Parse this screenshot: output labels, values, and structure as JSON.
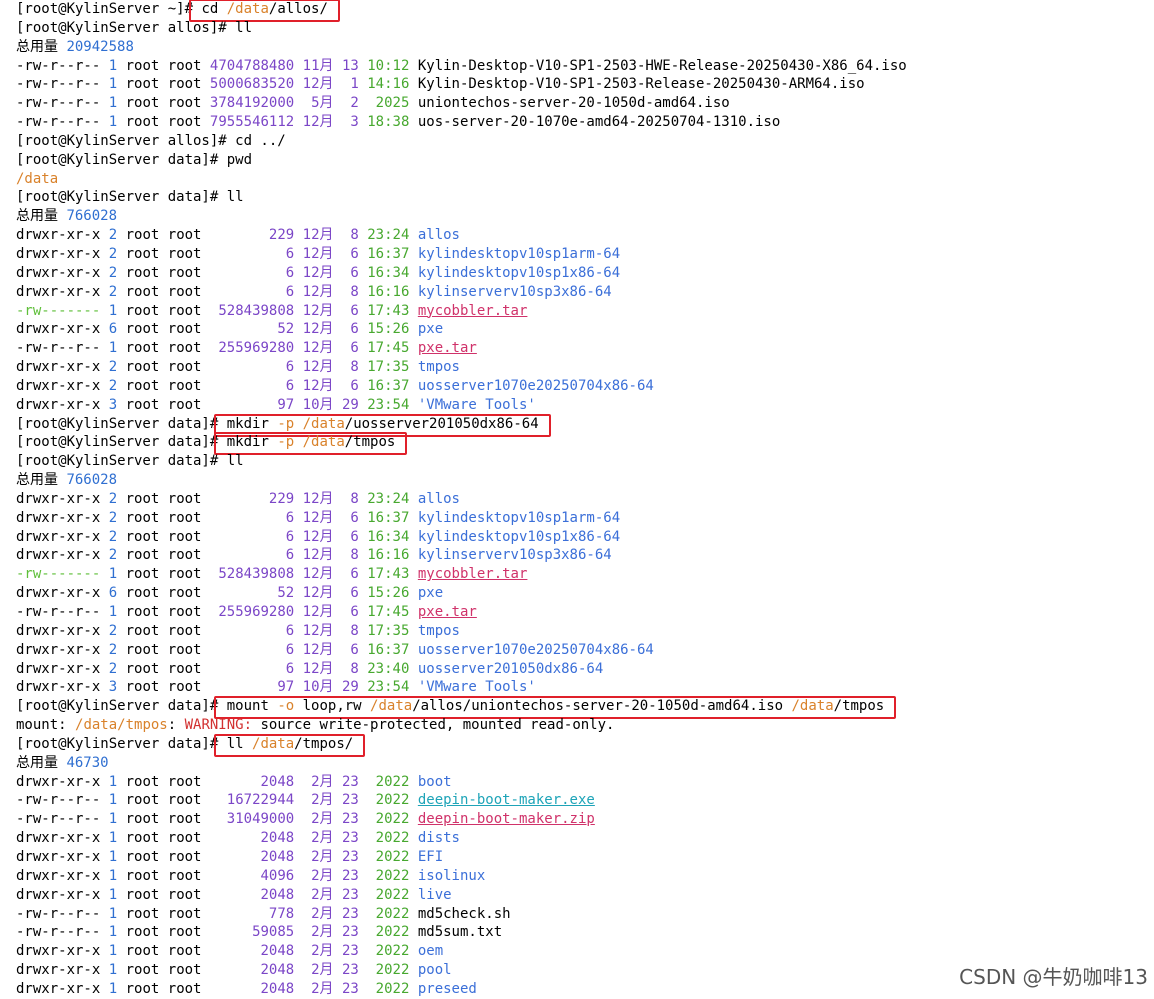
{
  "terminal": {
    "lines": [
      {
        "type": "prompt",
        "prompt": "[root@KylinServer ~]#",
        "cmd": " cd /data/allos/",
        "highlight": true
      },
      {
        "type": "prompt",
        "prompt": "[root@KylinServer allos]#",
        "cmd": " ll"
      },
      {
        "type": "total",
        "label": "总用量",
        "value": "20942588"
      },
      {
        "type": "file",
        "perm": "-rw-r--r--",
        "links": "1",
        "owner": "root",
        "group": "root",
        "size": "4704788480",
        "month": "11月",
        "day": "13",
        "time": "10:12",
        "name": "Kylin-Desktop-V10-SP1-2503-HWE-Release-20250430-X86_64.iso",
        "kind": "plain"
      },
      {
        "type": "file",
        "perm": "-rw-r--r--",
        "links": "1",
        "owner": "root",
        "group": "root",
        "size": "5000683520",
        "month": "12月",
        "day": "1",
        "time": "14:16",
        "name": "Kylin-Desktop-V10-SP1-2503-Release-20250430-ARM64.iso",
        "kind": "plain"
      },
      {
        "type": "file",
        "perm": "-rw-r--r--",
        "links": "1",
        "owner": "root",
        "group": "root",
        "size": "3784192000",
        "month": "5月",
        "day": "2",
        "time": "2025",
        "name": "uniontechos-server-20-1050d-amd64.iso",
        "kind": "plain"
      },
      {
        "type": "file",
        "perm": "-rw-r--r--",
        "links": "1",
        "owner": "root",
        "group": "root",
        "size": "7955546112",
        "month": "12月",
        "day": "3",
        "time": "18:38",
        "name": "uos-server-20-1070e-amd64-20250704-1310.iso",
        "kind": "plain"
      },
      {
        "type": "prompt",
        "prompt": "[root@KylinServer allos]#",
        "cmd": " cd ../"
      },
      {
        "type": "prompt",
        "prompt": "[root@KylinServer data]#",
        "cmd": " pwd"
      },
      {
        "type": "output",
        "text": "/data",
        "kind": "path"
      },
      {
        "type": "prompt",
        "prompt": "[root@KylinServer data]#",
        "cmd": " ll"
      },
      {
        "type": "total",
        "label": "总用量",
        "value": "766028"
      },
      {
        "type": "file",
        "perm": "drwxr-xr-x",
        "links": "2",
        "owner": "root",
        "group": "root",
        "size": "229",
        "month": "12月",
        "day": "8",
        "time": "23:24",
        "name": "allos",
        "kind": "dir"
      },
      {
        "type": "file",
        "perm": "drwxr-xr-x",
        "links": "2",
        "owner": "root",
        "group": "root",
        "size": "6",
        "month": "12月",
        "day": "6",
        "time": "16:37",
        "name": "kylindesktopv10sp1arm-64",
        "kind": "dir"
      },
      {
        "type": "file",
        "perm": "drwxr-xr-x",
        "links": "2",
        "owner": "root",
        "group": "root",
        "size": "6",
        "month": "12月",
        "day": "6",
        "time": "16:34",
        "name": "kylindesktopv10sp1x86-64",
        "kind": "dir"
      },
      {
        "type": "file",
        "perm": "drwxr-xr-x",
        "links": "2",
        "owner": "root",
        "group": "root",
        "size": "6",
        "month": "12月",
        "day": "8",
        "time": "16:16",
        "name": "kylinserverv10sp3x86-64",
        "kind": "dir"
      },
      {
        "type": "file",
        "perm": "-rw-------",
        "links": "1",
        "owner": "root",
        "group": "root",
        "size": "528439808",
        "month": "12月",
        "day": "6",
        "time": "17:43",
        "name": "mycobbler.tar",
        "kind": "arch"
      },
      {
        "type": "file",
        "perm": "drwxr-xr-x",
        "links": "6",
        "owner": "root",
        "group": "root",
        "size": "52",
        "month": "12月",
        "day": "6",
        "time": "15:26",
        "name": "pxe",
        "kind": "dir"
      },
      {
        "type": "file",
        "perm": "-rw-r--r--",
        "links": "1",
        "owner": "root",
        "group": "root",
        "size": "255969280",
        "month": "12月",
        "day": "6",
        "time": "17:45",
        "name": "pxe.tar",
        "kind": "arch"
      },
      {
        "type": "file",
        "perm": "drwxr-xr-x",
        "links": "2",
        "owner": "root",
        "group": "root",
        "size": "6",
        "month": "12月",
        "day": "8",
        "time": "17:35",
        "name": "tmpos",
        "kind": "dir"
      },
      {
        "type": "file",
        "perm": "drwxr-xr-x",
        "links": "2",
        "owner": "root",
        "group": "root",
        "size": "6",
        "month": "12月",
        "day": "6",
        "time": "16:37",
        "name": "uosserver1070e20250704x86-64",
        "kind": "dir"
      },
      {
        "type": "file",
        "perm": "drwxr-xr-x",
        "links": "3",
        "owner": "root",
        "group": "root",
        "size": "97",
        "month": "10月",
        "day": "29",
        "time": "23:54",
        "name": "'VMware Tools'",
        "kind": "dir"
      },
      {
        "type": "prompt",
        "prompt": "[root@KylinServer data]#",
        "cmd": " mkdir -p /data/uosserver201050dx86-64",
        "highlight": true
      },
      {
        "type": "prompt",
        "prompt": "[root@KylinServer data]#",
        "cmd": " mkdir -p /data/tmpos",
        "highlight": true
      },
      {
        "type": "prompt",
        "prompt": "[root@KylinServer data]#",
        "cmd": " ll"
      },
      {
        "type": "total",
        "label": "总用量",
        "value": "766028"
      },
      {
        "type": "file",
        "perm": "drwxr-xr-x",
        "links": "2",
        "owner": "root",
        "group": "root",
        "size": "229",
        "month": "12月",
        "day": "8",
        "time": "23:24",
        "name": "allos",
        "kind": "dir"
      },
      {
        "type": "file",
        "perm": "drwxr-xr-x",
        "links": "2",
        "owner": "root",
        "group": "root",
        "size": "6",
        "month": "12月",
        "day": "6",
        "time": "16:37",
        "name": "kylindesktopv10sp1arm-64",
        "kind": "dir"
      },
      {
        "type": "file",
        "perm": "drwxr-xr-x",
        "links": "2",
        "owner": "root",
        "group": "root",
        "size": "6",
        "month": "12月",
        "day": "6",
        "time": "16:34",
        "name": "kylindesktopv10sp1x86-64",
        "kind": "dir"
      },
      {
        "type": "file",
        "perm": "drwxr-xr-x",
        "links": "2",
        "owner": "root",
        "group": "root",
        "size": "6",
        "month": "12月",
        "day": "8",
        "time": "16:16",
        "name": "kylinserverv10sp3x86-64",
        "kind": "dir"
      },
      {
        "type": "file",
        "perm": "-rw-------",
        "links": "1",
        "owner": "root",
        "group": "root",
        "size": "528439808",
        "month": "12月",
        "day": "6",
        "time": "17:43",
        "name": "mycobbler.tar",
        "kind": "arch"
      },
      {
        "type": "file",
        "perm": "drwxr-xr-x",
        "links": "6",
        "owner": "root",
        "group": "root",
        "size": "52",
        "month": "12月",
        "day": "6",
        "time": "15:26",
        "name": "pxe",
        "kind": "dir"
      },
      {
        "type": "file",
        "perm": "-rw-r--r--",
        "links": "1",
        "owner": "root",
        "group": "root",
        "size": "255969280",
        "month": "12月",
        "day": "6",
        "time": "17:45",
        "name": "pxe.tar",
        "kind": "arch"
      },
      {
        "type": "file",
        "perm": "drwxr-xr-x",
        "links": "2",
        "owner": "root",
        "group": "root",
        "size": "6",
        "month": "12月",
        "day": "8",
        "time": "17:35",
        "name": "tmpos",
        "kind": "dir"
      },
      {
        "type": "file",
        "perm": "drwxr-xr-x",
        "links": "2",
        "owner": "root",
        "group": "root",
        "size": "6",
        "month": "12月",
        "day": "6",
        "time": "16:37",
        "name": "uosserver1070e20250704x86-64",
        "kind": "dir"
      },
      {
        "type": "file",
        "perm": "drwxr-xr-x",
        "links": "2",
        "owner": "root",
        "group": "root",
        "size": "6",
        "month": "12月",
        "day": "8",
        "time": "23:40",
        "name": "uosserver201050dx86-64",
        "kind": "dir"
      },
      {
        "type": "file",
        "perm": "drwxr-xr-x",
        "links": "3",
        "owner": "root",
        "group": "root",
        "size": "97",
        "month": "10月",
        "day": "29",
        "time": "23:54",
        "name": "'VMware Tools'",
        "kind": "dir"
      },
      {
        "type": "prompt",
        "prompt": "[root@KylinServer data]#",
        "cmd": " mount -o loop,rw /data/allos/uniontechos-server-20-1050d-amd64.iso /data/tmpos",
        "highlight": true
      },
      {
        "type": "mountmsg",
        "prefix": "mount: ",
        "path": "/data/tmpos",
        "sep": ": ",
        "warn": "WARNING:",
        "rest": " source write-protected, mounted read-only."
      },
      {
        "type": "prompt",
        "prompt": "[root@KylinServer data]#",
        "cmd": " ll /data/tmpos/",
        "highlight": true
      },
      {
        "type": "total",
        "label": "总用量",
        "value": "46730"
      },
      {
        "type": "file",
        "perm": "drwxr-xr-x",
        "links": "1",
        "owner": "root",
        "group": "root",
        "size": "2048",
        "month": "2月",
        "day": "23",
        "time": "2022",
        "name": "boot",
        "kind": "dir"
      },
      {
        "type": "file",
        "perm": "-rw-r--r--",
        "links": "1",
        "owner": "root",
        "group": "root",
        "size": "16722944",
        "month": "2月",
        "day": "23",
        "time": "2022",
        "name": "deepin-boot-maker.exe",
        "kind": "exec"
      },
      {
        "type": "file",
        "perm": "-rw-r--r--",
        "links": "1",
        "owner": "root",
        "group": "root",
        "size": "31049000",
        "month": "2月",
        "day": "23",
        "time": "2022",
        "name": "deepin-boot-maker.zip",
        "kind": "arch"
      },
      {
        "type": "file",
        "perm": "drwxr-xr-x",
        "links": "1",
        "owner": "root",
        "group": "root",
        "size": "2048",
        "month": "2月",
        "day": "23",
        "time": "2022",
        "name": "dists",
        "kind": "dir"
      },
      {
        "type": "file",
        "perm": "drwxr-xr-x",
        "links": "1",
        "owner": "root",
        "group": "root",
        "size": "2048",
        "month": "2月",
        "day": "23",
        "time": "2022",
        "name": "EFI",
        "kind": "dir"
      },
      {
        "type": "file",
        "perm": "drwxr-xr-x",
        "links": "1",
        "owner": "root",
        "group": "root",
        "size": "4096",
        "month": "2月",
        "day": "23",
        "time": "2022",
        "name": "isolinux",
        "kind": "dir"
      },
      {
        "type": "file",
        "perm": "drwxr-xr-x",
        "links": "1",
        "owner": "root",
        "group": "root",
        "size": "2048",
        "month": "2月",
        "day": "23",
        "time": "2022",
        "name": "live",
        "kind": "dir"
      },
      {
        "type": "file",
        "perm": "-rw-r--r--",
        "links": "1",
        "owner": "root",
        "group": "root",
        "size": "778",
        "month": "2月",
        "day": "23",
        "time": "2022",
        "name": "md5check.sh",
        "kind": "plain"
      },
      {
        "type": "file",
        "perm": "-rw-r--r--",
        "links": "1",
        "owner": "root",
        "group": "root",
        "size": "59085",
        "month": "2月",
        "day": "23",
        "time": "2022",
        "name": "md5sum.txt",
        "kind": "plain"
      },
      {
        "type": "file",
        "perm": "drwxr-xr-x",
        "links": "1",
        "owner": "root",
        "group": "root",
        "size": "2048",
        "month": "2月",
        "day": "23",
        "time": "2022",
        "name": "oem",
        "kind": "dir"
      },
      {
        "type": "file",
        "perm": "drwxr-xr-x",
        "links": "1",
        "owner": "root",
        "group": "root",
        "size": "2048",
        "month": "2月",
        "day": "23",
        "time": "2022",
        "name": "pool",
        "kind": "dir"
      },
      {
        "type": "file",
        "perm": "drwxr-xr-x",
        "links": "1",
        "owner": "root",
        "group": "root",
        "size": "2048",
        "month": "2月",
        "day": "23",
        "time": "2022",
        "name": "preseed",
        "kind": "dir"
      }
    ]
  },
  "watermark": "CSDN @牛奶咖啡13",
  "colors": {
    "highlight_box": "#e0202a",
    "dir": "#3b6fd8",
    "archive": "#d0326a",
    "exec": "#1ea4b8",
    "size": "#7b46c7",
    "time": "#47a82f",
    "path": "#d9822b",
    "warning": "#d23131"
  }
}
